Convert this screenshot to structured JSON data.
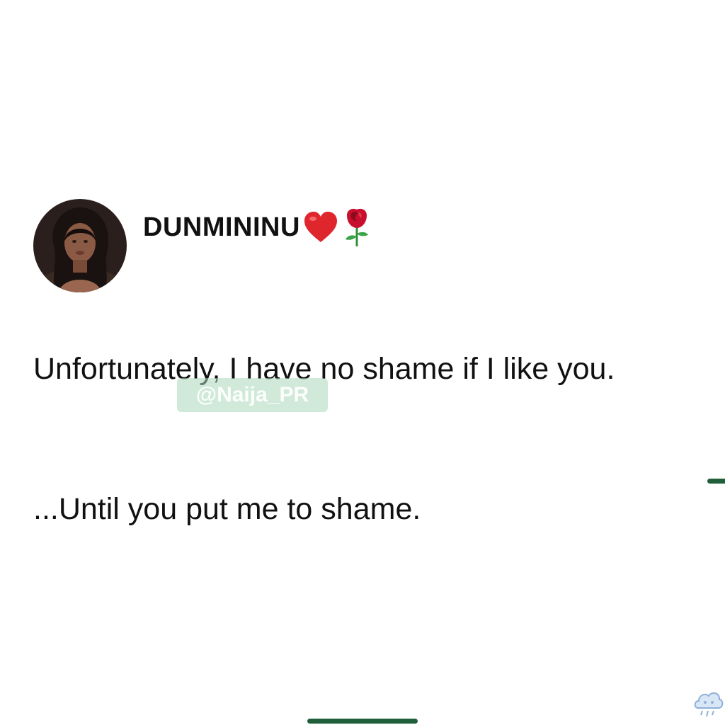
{
  "tweet": {
    "display_name": "DUNMININU",
    "name_emojis": [
      "red-heart",
      "rose"
    ],
    "text_paragraphs": [
      "Unfortunately, I have no shame if I like you.",
      "...Until you put me to shame."
    ]
  },
  "watermark": {
    "text": "@Naija_PR"
  },
  "colors": {
    "text": "#111111",
    "watermark_bg": "#aad7b9",
    "indicator": "#1f5f3a",
    "heart": "#e0262d"
  }
}
